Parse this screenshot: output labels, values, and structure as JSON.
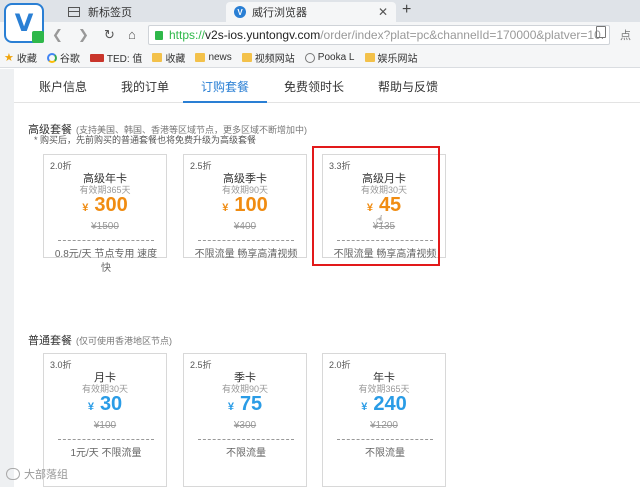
{
  "browser": {
    "tabs": [
      {
        "label": "新标签页",
        "active": false
      },
      {
        "label": "威行浏览器",
        "active": true
      }
    ],
    "new_tab_symbol": "+",
    "url": {
      "scheme": "https://",
      "host": "v2s-ios.yuntongv.com",
      "path": "/order/index?plat=pc&channelId=170000&platver=10."
    },
    "right_text": "点",
    "bookmarks": [
      {
        "label": "收藏",
        "icon": "star-icon"
      },
      {
        "label": "谷歌",
        "icon": "google-icon"
      },
      {
        "label": "TED: 值",
        "icon": "ted-icon"
      },
      {
        "label": "收藏",
        "icon": "folder-icon"
      },
      {
        "label": "news",
        "icon": "folder-icon"
      },
      {
        "label": "视频网站",
        "icon": "folder-icon"
      },
      {
        "label": "Pooka L",
        "icon": "pooka-icon"
      },
      {
        "label": "娱乐网站",
        "icon": "folder-icon"
      }
    ]
  },
  "subnav": [
    {
      "label": "账户信息",
      "active": false
    },
    {
      "label": "我的订单",
      "active": false
    },
    {
      "label": "订购套餐",
      "active": true
    },
    {
      "label": "免费领时长",
      "active": false
    },
    {
      "label": "帮助与反馈",
      "active": false
    }
  ],
  "premium": {
    "title": "高级套餐",
    "note": "(支持美国、韩国、香港等区域节点，更多区域不断增加中)",
    "tip": "* 购买后，先前购买的普通套餐也将免费升级为高级套餐",
    "plans": [
      {
        "discount": "2.0折",
        "name": "高级年卡",
        "valid": "有效期365天",
        "currency": "¥",
        "price": "300",
        "original": "¥1500",
        "desc": "0.8元/天 节点专用 速度快"
      },
      {
        "discount": "2.5折",
        "name": "高级季卡",
        "valid": "有效期90天",
        "currency": "¥",
        "price": "100",
        "original": "¥400",
        "desc": "不限流量 畅享高清视频"
      },
      {
        "discount": "3.3折",
        "name": "高级月卡",
        "valid": "有效期30天",
        "currency": "¥",
        "price": "45",
        "original": "¥135",
        "desc": "不限流量 畅享高清视频"
      }
    ]
  },
  "standard": {
    "title": "普通套餐",
    "note": "(仅可使用香港地区节点)",
    "plans": [
      {
        "discount": "3.0折",
        "name": "月卡",
        "valid": "有效期30天",
        "currency": "¥",
        "price": "30",
        "original": "¥100",
        "desc": "1元/天 不限流量"
      },
      {
        "discount": "2.5折",
        "name": "季卡",
        "valid": "有效期90天",
        "currency": "¥",
        "price": "75",
        "original": "¥300",
        "desc": "不限流量"
      },
      {
        "discount": "2.0折",
        "name": "年卡",
        "valid": "有效期365天",
        "currency": "¥",
        "price": "240",
        "original": "¥1200",
        "desc": "不限流量"
      }
    ]
  },
  "colors": {
    "premium_price": "#f08c12",
    "standard_price": "#2a9ce6",
    "highlight": "#e2191a",
    "accent": "#2a7fd4"
  },
  "watermark": "大部落组"
}
